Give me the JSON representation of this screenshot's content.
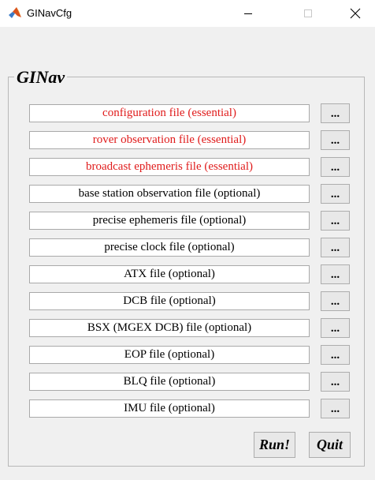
{
  "window": {
    "title": "GINavCfg",
    "icon": "matlab-icon"
  },
  "group": {
    "title": "GINav"
  },
  "files": [
    {
      "label": "configuration file (essential)",
      "kind": "essential"
    },
    {
      "label": "rover observation file (essential)",
      "kind": "essential"
    },
    {
      "label": "broadcast ephemeris file (essential)",
      "kind": "essential"
    },
    {
      "label": "base station observation file (optional)",
      "kind": "optional"
    },
    {
      "label": "precise ephemeris file (optional)",
      "kind": "optional"
    },
    {
      "label": "precise clock file (optional)",
      "kind": "optional"
    },
    {
      "label": "ATX file (optional)",
      "kind": "optional"
    },
    {
      "label": "DCB file (optional)",
      "kind": "optional"
    },
    {
      "label": "BSX (MGEX DCB) file (optional)",
      "kind": "optional"
    },
    {
      "label": "EOP file (optional)",
      "kind": "optional"
    },
    {
      "label": "BLQ file (optional)",
      "kind": "optional"
    },
    {
      "label": "IMU file (optional)",
      "kind": "optional"
    }
  ],
  "browse_label": "...",
  "buttons": {
    "run": "Run!",
    "quit": "Quit"
  },
  "colors": {
    "essential_text": "#e01b1b",
    "optional_text": "#000000",
    "window_bg": "#f0f0f0"
  }
}
